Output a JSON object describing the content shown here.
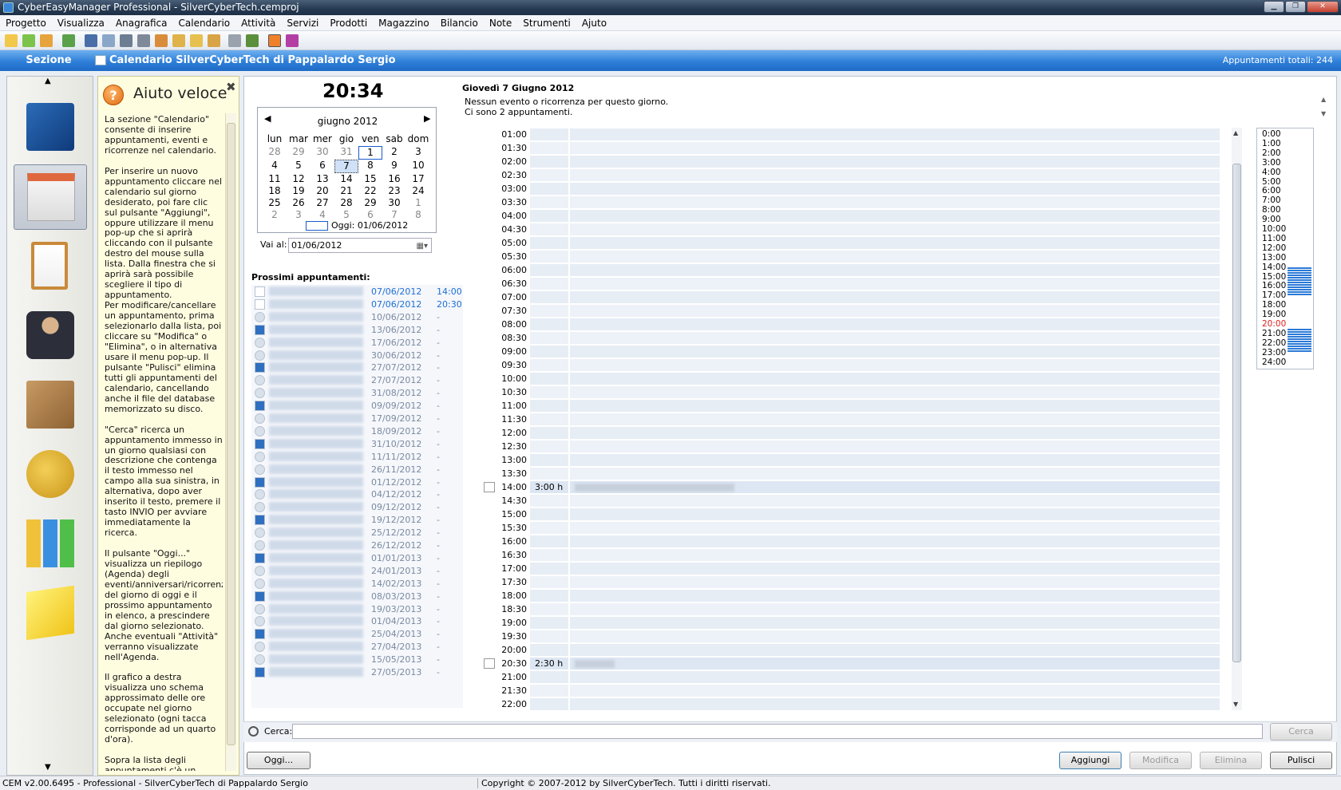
{
  "window": {
    "title": "CyberEasyManager Professional - SilverCyberTech.cemproj"
  },
  "menu": [
    "Progetto",
    "Visualizza",
    "Anagrafica",
    "Calendario",
    "Attività",
    "Servizi",
    "Prodotti",
    "Magazzino",
    "Bilancio",
    "Note",
    "Strumenti",
    "Ajuto"
  ],
  "header": {
    "section": "Sezione",
    "calendar_title": "Calendario SilverCyberTech di Pappalardo Sergio",
    "total": "Appuntamenti totali: 244"
  },
  "help": {
    "title": "Aiuto veloce",
    "text": "La sezione \"Calendario\" consente di inserire appuntamenti, eventi e ricorrenze nel calendario.\n\nPer inserire un nuovo appuntamento cliccare nel calendario sul giorno desiderato, poi fare clic sul pulsante \"Aggiungi\", oppure utilizzare il menu pop-up che si aprirà cliccando con il pulsante destro del mouse sulla lista. Dalla finestra che si aprirà sarà possibile scegliere il tipo di appuntamento.\nPer modificare/cancellare un appuntamento, prima selezionarlo dalla lista, poi cliccare su \"Modifica\" o \"Elimina\", o in alternativa usare il menu pop-up. Il pulsante \"Pulisci\" elimina tutti gli appuntamenti del calendario, cancellando anche il file del database memorizzato su disco.\n\n\"Cerca\" ricerca un appuntamento immesso in un giorno qualsiasi con descrizione che contenga il testo immesso nel campo alla sua sinistra, in alternativa, dopo aver inserito il testo, premere il tasto INVIO per avviare immediatamente la ricerca.\n\nIl pulsante \"Oggi...\" visualizza un riepilogo (Agenda) degli eventi/anniversari/ricorrenze del giorno di oggi e il prossimo appuntamento in elenco, a prescindere dal giorno selezionato. Anche eventuali \"Attività\" verranno visualizzate nell'Agenda.\n\nIl grafico a destra visualizza uno schema approssimato delle ore occupate nel giorno selezionato (ogni tacca corrisponde ad un quarto d'ora).\n\nSopra la lista degli appuntamenti c'è un breve riepilogo di eventi, ricorrenze, attività in scadenza e appuntamenti"
  },
  "clock": "20:34",
  "mini_calendar": {
    "month": "giugno 2012",
    "weekdays": [
      "lun",
      "mar",
      "mer",
      "gio",
      "ven",
      "sab",
      "dom"
    ],
    "days": [
      "28",
      "29",
      "30",
      "31",
      "1",
      "2",
      "3",
      "4",
      "5",
      "6",
      "7",
      "8",
      "9",
      "10",
      "11",
      "12",
      "13",
      "14",
      "15",
      "16",
      "17",
      "18",
      "19",
      "20",
      "21",
      "22",
      "23",
      "24",
      "25",
      "26",
      "27",
      "28",
      "29",
      "30",
      "1",
      "2",
      "3",
      "4",
      "5",
      "6",
      "7",
      "8"
    ],
    "today_label": "Oggi: 01/06/2012"
  },
  "goto": {
    "label": "Vai al:",
    "value": "01/06/2012"
  },
  "upcoming": {
    "title": "Prossimi appuntamenti:",
    "rows": [
      {
        "date": "07/06/2012",
        "time": "14:00",
        "highlight": true
      },
      {
        "date": "07/06/2012",
        "time": "20:30",
        "highlight": true
      },
      {
        "date": "10/06/2012",
        "time": "-"
      },
      {
        "date": "13/06/2012",
        "time": "-"
      },
      {
        "date": "17/06/2012",
        "time": "-"
      },
      {
        "date": "30/06/2012",
        "time": "-"
      },
      {
        "date": "27/07/2012",
        "time": "-"
      },
      {
        "date": "27/07/2012",
        "time": "-"
      },
      {
        "date": "31/08/2012",
        "time": "-"
      },
      {
        "date": "09/09/2012",
        "time": "-"
      },
      {
        "date": "17/09/2012",
        "time": "-"
      },
      {
        "date": "18/09/2012",
        "time": "-"
      },
      {
        "date": "31/10/2012",
        "time": "-"
      },
      {
        "date": "11/11/2012",
        "time": "-"
      },
      {
        "date": "26/11/2012",
        "time": "-"
      },
      {
        "date": "01/12/2012",
        "time": "-"
      },
      {
        "date": "04/12/2012",
        "time": "-"
      },
      {
        "date": "09/12/2012",
        "time": "-"
      },
      {
        "date": "19/12/2012",
        "time": "-"
      },
      {
        "date": "25/12/2012",
        "time": "-"
      },
      {
        "date": "26/12/2012",
        "time": "-"
      },
      {
        "date": "01/01/2013",
        "time": "-"
      },
      {
        "date": "24/01/2013",
        "time": "-"
      },
      {
        "date": "14/02/2013",
        "time": "-"
      },
      {
        "date": "08/03/2013",
        "time": "-"
      },
      {
        "date": "19/03/2013",
        "time": "-"
      },
      {
        "date": "01/04/2013",
        "time": "-"
      },
      {
        "date": "25/04/2013",
        "time": "-"
      },
      {
        "date": "27/04/2013",
        "time": "-"
      },
      {
        "date": "15/05/2013",
        "time": "-"
      },
      {
        "date": "27/05/2013",
        "time": "-"
      }
    ]
  },
  "day": {
    "heading": "Giovedì 7 Giugno 2012",
    "line1": "Nessun evento o ricorrenza per questo giorno.",
    "line2": "Ci sono 2 appuntamenti."
  },
  "agenda": {
    "slots": [
      "01:00",
      "01:30",
      "02:00",
      "02:30",
      "03:00",
      "03:30",
      "04:00",
      "04:30",
      "05:00",
      "05:30",
      "06:00",
      "06:30",
      "07:00",
      "07:30",
      "08:00",
      "08:30",
      "09:00",
      "09:30",
      "10:00",
      "10:30",
      "11:00",
      "11:30",
      "12:00",
      "12:30",
      "13:00",
      "13:30",
      "14:00",
      "14:30",
      "15:00",
      "15:30",
      "16:00",
      "16:30",
      "17:00",
      "17:30",
      "18:00",
      "18:30",
      "19:00",
      "19:30",
      "20:00",
      "20:30",
      "21:00",
      "21:30",
      "22:00"
    ],
    "appointments": [
      {
        "slot": "14:00",
        "duration": "3:00 h"
      },
      {
        "slot": "20:30",
        "duration": "2:30 h"
      }
    ]
  },
  "hours_chart": {
    "labels": [
      "0:00",
      "1:00",
      "2:00",
      "3:00",
      "4:00",
      "5:00",
      "6:00",
      "7:00",
      "8:00",
      "9:00",
      "10:00",
      "11:00",
      "12:00",
      "13:00",
      "14:00",
      "15:00",
      "16:00",
      "17:00",
      "18:00",
      "19:00",
      "20:00",
      "21:00",
      "22:00",
      "23:00",
      "24:00"
    ],
    "current_hour": "20:00",
    "current_color": "#e02020",
    "busy_color": "#2b7ad6",
    "busy_ranges": [
      [
        14,
        17
      ],
      [
        20.5,
        23
      ]
    ]
  },
  "search": {
    "label": "Cerca:",
    "button": "Cerca"
  },
  "buttons": {
    "today": "Oggi...",
    "add": "Aggiungi",
    "edit": "Modifica",
    "delete": "Elimina",
    "clear": "Pulisci"
  },
  "status": {
    "left": "CEM v2.00.6495 - Professional - SilverCyberTech di Pappalardo Sergio",
    "right": "Copyright © 2007-2012 by SilverCyberTech. Tutti i diritti riservati."
  },
  "sidebar": {
    "items": [
      "address-book-icon",
      "calendar-icon",
      "clipboard-icon",
      "people-icon",
      "boxes-icon",
      "coins-icon",
      "bar-chart-icon",
      "sticky-note-icon"
    ],
    "selected": 1
  }
}
